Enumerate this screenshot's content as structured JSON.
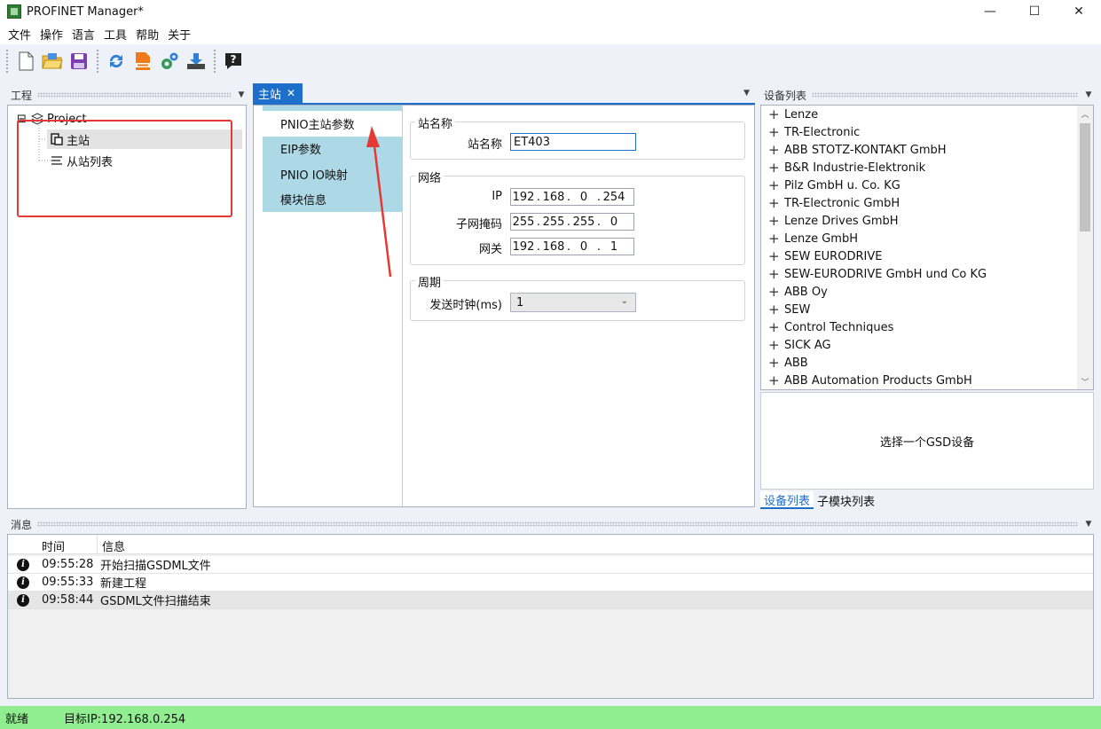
{
  "window": {
    "title": "PROFINET Manager*",
    "minimize": "—",
    "maximize": "☐",
    "close": "✕"
  },
  "menu": [
    "文件",
    "操作",
    "语言",
    "工具",
    "帮助",
    "关于"
  ],
  "toolbar": {
    "icons": [
      "new-file-icon",
      "open-folder-icon",
      "save-icon",
      "refresh-icon",
      "gsdml-icon",
      "settings-gears-icon",
      "download-icon",
      "help-icon"
    ]
  },
  "project_panel": {
    "title": "工程",
    "tree": {
      "root": "Project",
      "expander": "⊟",
      "children": [
        "主站",
        "从站列表"
      ]
    }
  },
  "center": {
    "tab_label": "主站",
    "tab_close": "✕",
    "side_tabs": [
      "PNIO主站参数",
      "EIP参数",
      "PNIO IO映射",
      "模块信息"
    ],
    "station_group": {
      "title": "站名称",
      "label": "站名称",
      "value": "ET403"
    },
    "network_group": {
      "title": "网络",
      "ip_label": "IP",
      "ip": [
        "192",
        "168",
        "0",
        "254"
      ],
      "mask_label": "子网掩码",
      "mask": [
        "255",
        "255",
        "255",
        "0"
      ],
      "gateway_label": "网关",
      "gateway": [
        "192",
        "168",
        "0",
        "1"
      ]
    },
    "cycle_group": {
      "title": "周期",
      "label": "发送时钟(ms)",
      "value": "1"
    }
  },
  "device_panel": {
    "title": "设备列表",
    "items": [
      "Lenze",
      "TR-Electronic",
      "ABB STOTZ-KONTAKT GmbH",
      "B&R Industrie-Elektronik",
      "Pilz GmbH u. Co. KG",
      "TR-Electronic GmbH",
      "Lenze Drives GmbH",
      "Lenze GmbH",
      "SEW EURODRIVE",
      "SEW-EURODRIVE GmbH und Co KG",
      "ABB Oy",
      "SEW",
      "Control Techniques",
      "SICK AG",
      "ABB",
      "ABB Automation Products GmbH"
    ],
    "detail_text": "选择一个GSD设备",
    "tabs": [
      "设备列表",
      "子模块列表"
    ]
  },
  "messages": {
    "title": "消息",
    "columns": [
      "时间",
      "信息"
    ],
    "rows": [
      {
        "time": "09:55:28",
        "text": "开始扫描GSDML文件"
      },
      {
        "time": "09:55:33",
        "text": "新建工程"
      },
      {
        "time": "09:58:44",
        "text": "GSDML文件扫描结束"
      }
    ]
  },
  "status": {
    "state": "就绪",
    "target": "目标IP:192.168.0.254"
  },
  "colors": {
    "accent": "#1e6fc9",
    "side_tab_bg": "#add8e6",
    "status_bg": "#90ee90",
    "highlight_red": "#e53935"
  }
}
